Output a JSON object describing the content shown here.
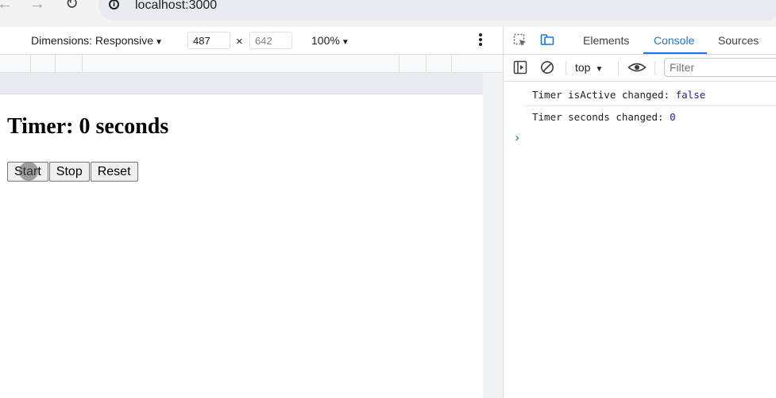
{
  "browser": {
    "url": "localhost:3000",
    "back_icon": "arrow-left-icon",
    "forward_icon": "arrow-right-icon",
    "reload_icon": "reload-icon"
  },
  "device_toolbar": {
    "dimensions_label": "Dimensions: Responsive",
    "width_value": "487",
    "height_value": "642",
    "times": "×",
    "zoom_label": "100%"
  },
  "page": {
    "title": "Timer: 0 seconds",
    "buttons": {
      "start": "Start",
      "stop": "Stop",
      "reset": "Reset"
    }
  },
  "devtools": {
    "tabs": [
      "Elements",
      "Console",
      "Sources"
    ],
    "active_tab": "Console",
    "context": "top",
    "filter_placeholder": "Filter",
    "logs": [
      {
        "text": "Timer isActive changed: ",
        "value": "false"
      },
      {
        "text": "Timer seconds changed: ",
        "value": "0"
      }
    ],
    "prompt": "›"
  },
  "colors": {
    "accent": "#1a73e8",
    "log_value": "#1a1aa6"
  }
}
